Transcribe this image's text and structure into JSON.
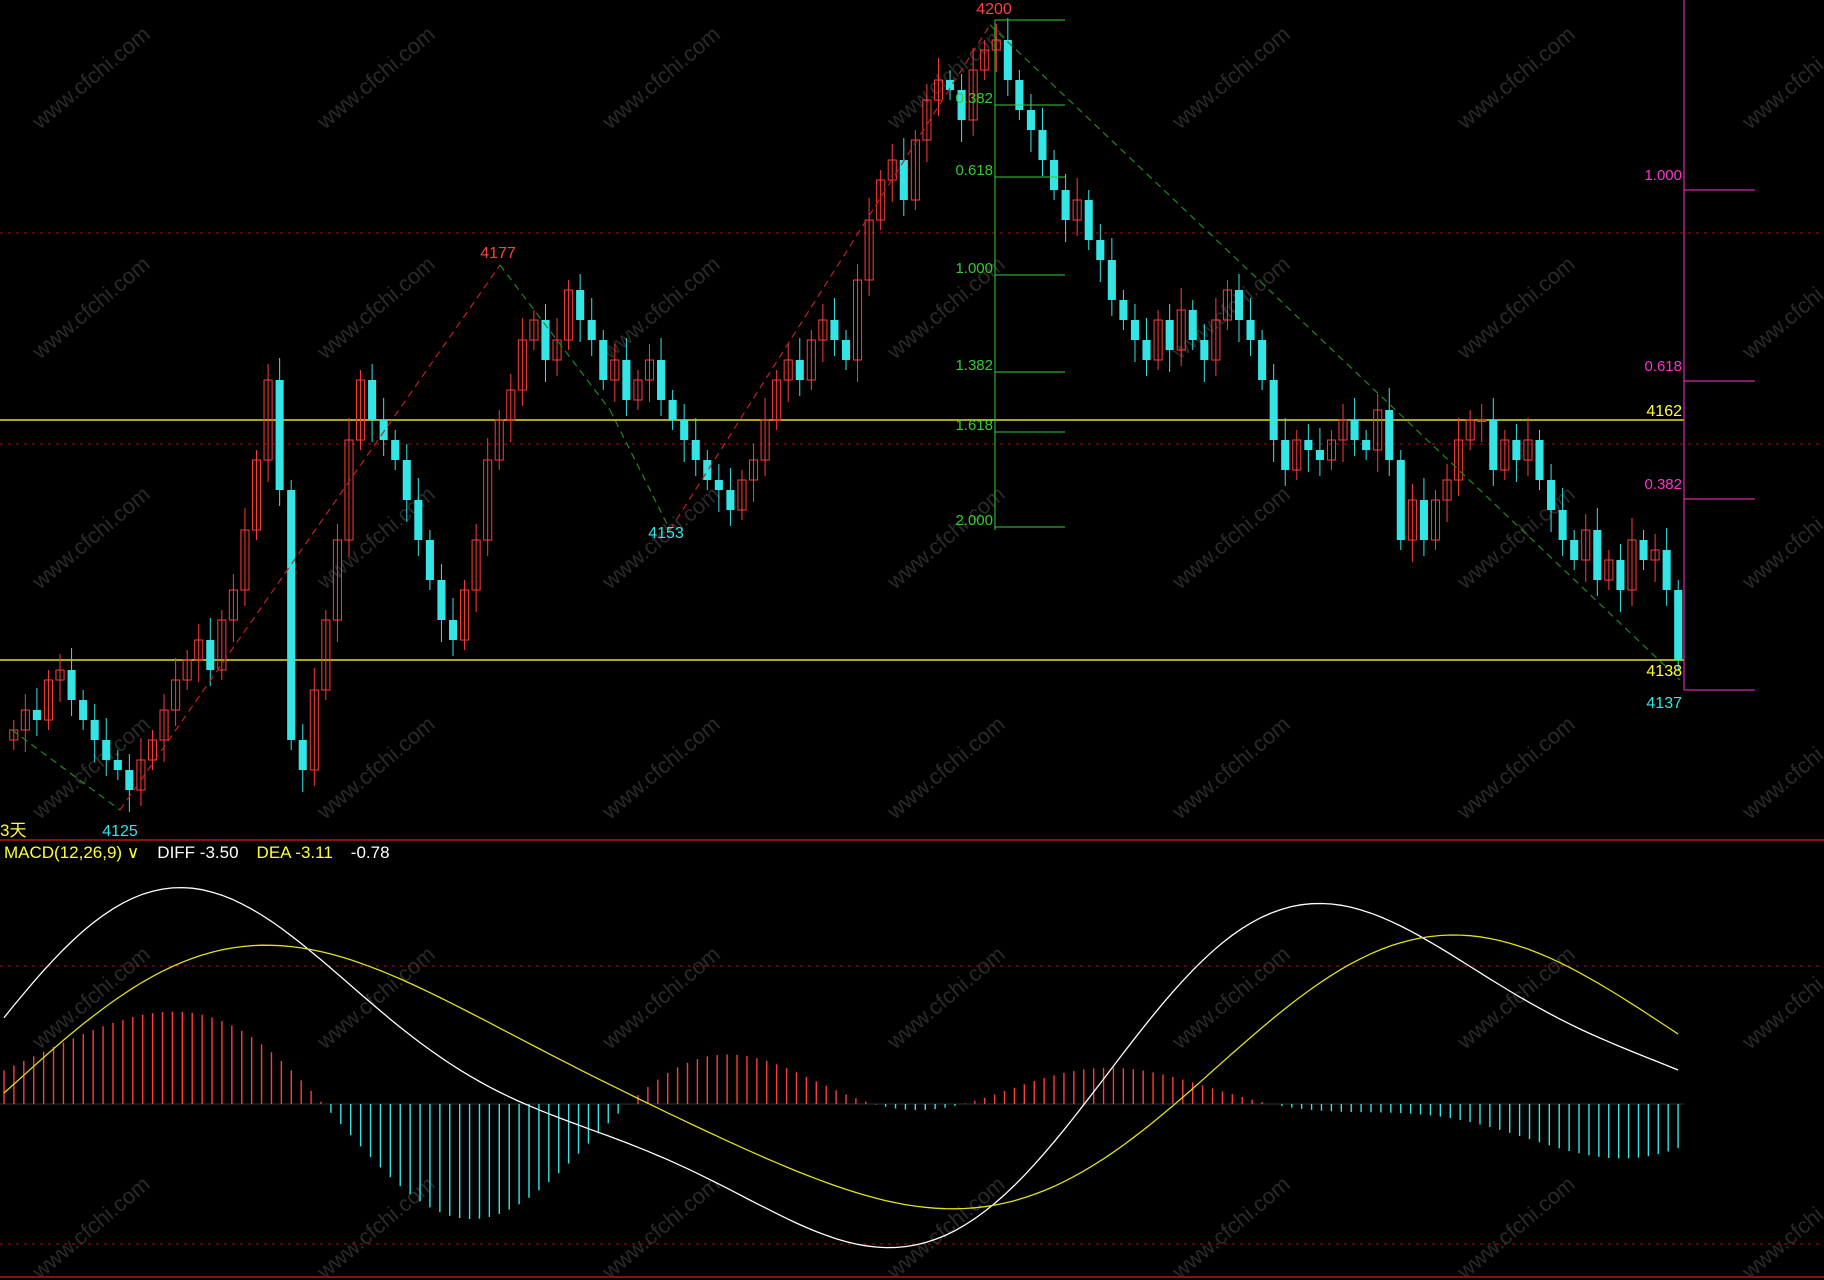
{
  "colors": {
    "background": "#000000",
    "up": "#ff3b3b",
    "down": "#33e5e5",
    "fib_green": "#33cc33",
    "fib_magenta": "#ff33cc",
    "count_green": "#22bb22",
    "count_magenta": "#ff33cc",
    "count_yellow": "#ffff22",
    "diff_line": "#ffffff",
    "dea_line": "#e0e020",
    "hline": "#e0e020",
    "dotted_red": "#a01818"
  },
  "watermark": "www.cfchi.com",
  "main": {
    "period_label": "3天",
    "peak_high": "4200",
    "peak_low_left": "4125",
    "peak_mid_high": "4177",
    "peak_mid_low": "4153",
    "right_level_1": "4162",
    "right_level_2": "4138",
    "right_level_3": "4137",
    "left_fib_levels": [
      "0.382",
      "0.618",
      "1.000",
      "1.382",
      "1.618",
      "2.000"
    ],
    "right_fib_levels": [
      "1.000",
      "0.618",
      "0.382"
    ]
  },
  "indicator": {
    "name": "MACD(12,26,9)",
    "dropdown_icon": "chevron-down-icon",
    "diff_label": "DIFF -3.50",
    "dea_label": "DEA -3.11",
    "hist_value": "-0.78"
  },
  "chart_data": {
    "type": "candlestick",
    "y_range": [
      4122,
      4202
    ],
    "horizontal_levels": [
      4162,
      4138
    ],
    "candles_note": "approximate OHLC read from image",
    "close_path": [
      4131,
      4133,
      4132,
      4136,
      4137,
      4134,
      4132,
      4130,
      4128,
      4127,
      4125,
      4128,
      4130,
      4133,
      4136,
      4138,
      4140,
      4137,
      4142,
      4145,
      4151,
      4158,
      4166,
      4155,
      4130,
      4127,
      4135,
      4142,
      4150,
      4160,
      4166,
      4162,
      4160,
      4158,
      4154,
      4150,
      4146,
      4142,
      4140,
      4145,
      4150,
      4158,
      4162,
      4165,
      4170,
      4172,
      4168,
      4170,
      4175,
      4172,
      4170,
      4166,
      4168,
      4164,
      4166,
      4168,
      4164,
      4162,
      4160,
      4158,
      4156,
      4155,
      4153,
      4156,
      4158,
      4162,
      4166,
      4168,
      4166,
      4170,
      4172,
      4170,
      4168,
      4176,
      4182,
      4186,
      4188,
      4184,
      4190,
      4194,
      4196,
      4195,
      4192,
      4197,
      4199,
      4200,
      4196,
      4193,
      4191,
      4188,
      4185,
      4182,
      4184,
      4180,
      4178,
      4174,
      4172,
      4170,
      4168,
      4172,
      4169,
      4173,
      4170,
      4168,
      4172,
      4175,
      4172,
      4170,
      4166,
      4160,
      4157,
      4160,
      4159,
      4158,
      4160,
      4162,
      4160,
      4159,
      4163,
      4158,
      4150,
      4154,
      4150,
      4154,
      4156,
      4160,
      4162,
      4162,
      4157,
      4160,
      4158,
      4160,
      4156,
      4153,
      4150,
      4148,
      4151,
      4146,
      4148,
      4145,
      4150,
      4148,
      4149,
      4145,
      4138
    ],
    "macd": {
      "diff_label": "DIFF -3.50",
      "dea_label": "DEA -3.11",
      "hist_label": "-0.78"
    }
  }
}
